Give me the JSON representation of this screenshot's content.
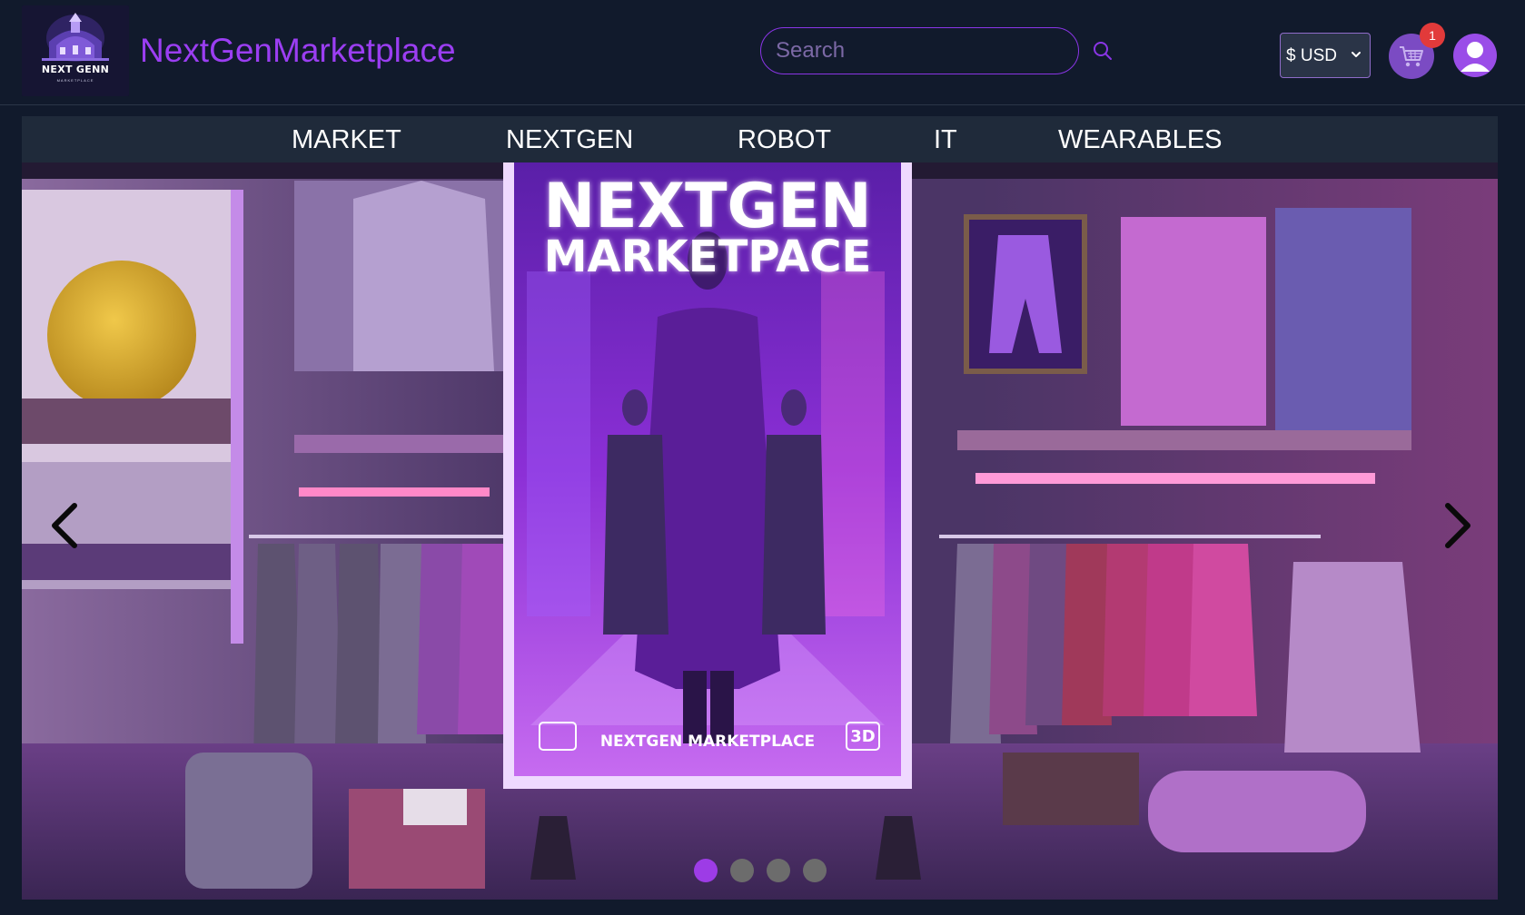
{
  "header": {
    "logo": {
      "text": "NEXT GENN",
      "subtext": "MARKETPLACE"
    },
    "brand": "NextGenMarketplace",
    "search": {
      "placeholder": "Search",
      "value": ""
    },
    "currency": {
      "selected": "$ USD"
    },
    "cart": {
      "count": "1"
    },
    "icons": {
      "search": "search-icon",
      "cart": "shopping-cart-icon",
      "account": "user-icon",
      "dropdown": "chevron-down-icon"
    }
  },
  "nav": {
    "items": [
      {
        "label": "MARKET"
      },
      {
        "label": "NEXTGEN"
      },
      {
        "label": "ROBOT"
      },
      {
        "label": "IT"
      },
      {
        "label": "WEARABLES"
      }
    ]
  },
  "hero": {
    "poster": {
      "title_line1": "NEXTGEN",
      "title_line2": "MARKETPACE",
      "footer": "NEXTGEN MARKETPLACE",
      "badge": "3D"
    },
    "slides": {
      "count": 4,
      "active": 1
    },
    "icons": {
      "prev": "chevron-left-icon",
      "next": "chevron-right-icon"
    }
  },
  "colors": {
    "background": "#111a2c",
    "accent": "#9b3ef2",
    "nav_background": "#1f2a3a",
    "badge": "#e23a3a",
    "dot_active": "#9d3ce6",
    "dot_inactive": "#6c6c6c"
  }
}
